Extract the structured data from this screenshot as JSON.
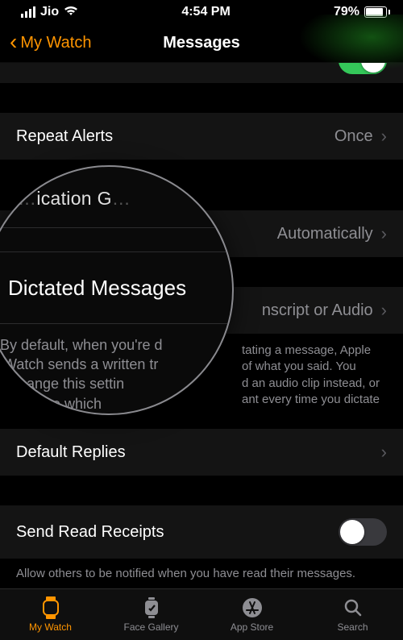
{
  "status": {
    "carrier": "Jio",
    "time": "4:54 PM",
    "battery_pct": "79%"
  },
  "nav": {
    "back_label": "My Watch",
    "title": "Messages"
  },
  "rows": {
    "repeat_alerts": {
      "label": "Repeat Alerts",
      "value": "Once"
    },
    "notif_grouping": {
      "value": "Automatically"
    },
    "dictated": {
      "label": "Dictated Messages",
      "value": "Transcript or Audio"
    },
    "default_replies": {
      "label": "Default Replies"
    },
    "read_receipts": {
      "label": "Send Read Receipts",
      "on": false
    }
  },
  "footers": {
    "dictated": "By default, when you're done dictating a message, Apple Watch sends a written transcript of what you said. You can change this setting to send an audio clip instead, or choose which one you want every time you dictate a message.",
    "read_receipts": "Allow others to be notified when you have read their messages."
  },
  "magnifier": {
    "top_partial": "…ication G…",
    "heading": "Dictated Messages",
    "body_l1": "By default, when you're d",
    "body_l2": "Watch sends a written tr",
    "body_l3": "change this settin",
    "body_l4": "se which"
  },
  "dictated_visible": {
    "l1": "tating a message, Apple",
    "l2": "of what you said. You",
    "l3": "d an audio clip instead, or",
    "l4": "ant every time you dictate"
  },
  "tabs": {
    "my_watch": "My Watch",
    "face_gallery": "Face Gallery",
    "app_store": "App Store",
    "search": "Search"
  }
}
